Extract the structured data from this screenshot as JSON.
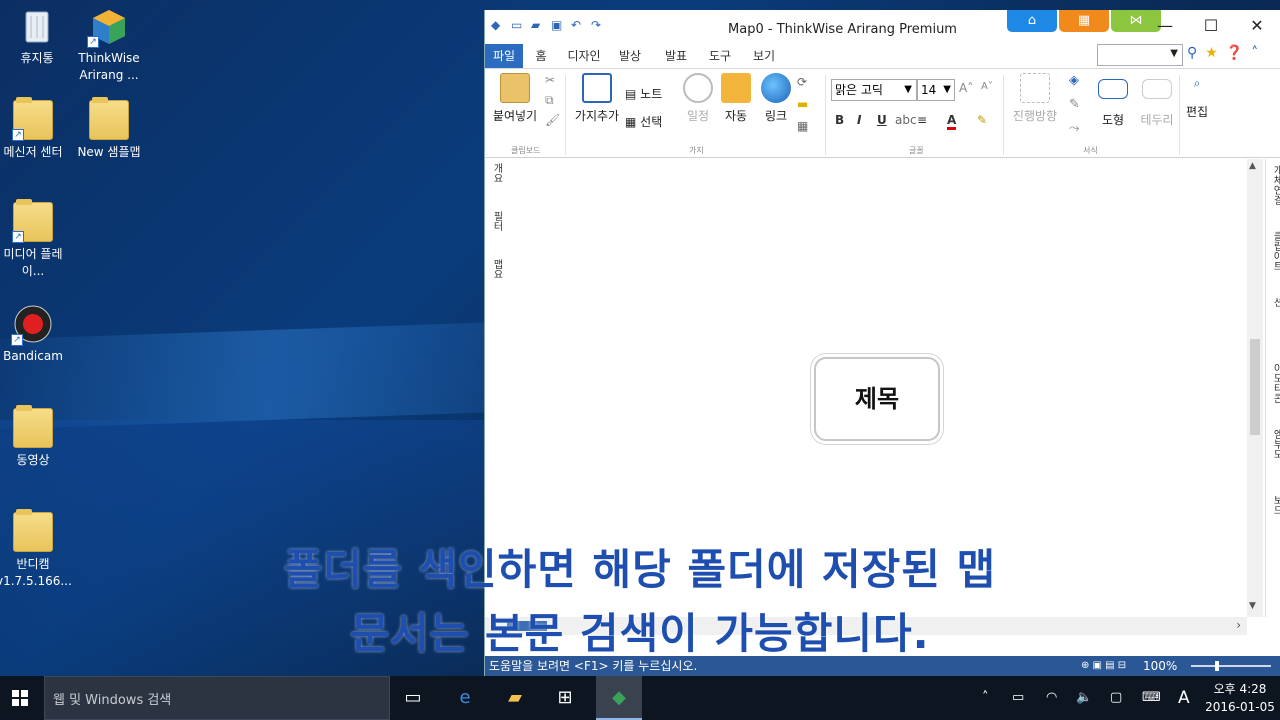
{
  "desktop": {
    "icons": [
      {
        "label": "휴지통"
      },
      {
        "label": "ThinkWise Arirang ..."
      },
      {
        "label": "메신저 센터"
      },
      {
        "label": "New 샘플맵"
      },
      {
        "label": "미디어 플레이..."
      },
      {
        "label": "Bandicam"
      },
      {
        "label": "동영상"
      },
      {
        "label": "반디캠 v1.7.5.166..."
      }
    ]
  },
  "app": {
    "title": "Map0 - ThinkWise Arirang Premium",
    "tabs": [
      "파일",
      "홈",
      "디자인",
      "발상",
      "발표",
      "도구",
      "보기"
    ],
    "ribbon": {
      "paste": "붙여넣기",
      "clipboard_group": "클립보드",
      "add_branch": "가지추가",
      "note": "노트",
      "select": "선택",
      "schedule": "일정",
      "auto": "자동",
      "link": "링크",
      "branch_group": "가지",
      "font_name": "맑은 고딕",
      "font_size": "14",
      "bold": "B",
      "italic": "I",
      "underline": "U",
      "font_group": "글꼴",
      "progress": "진행방향",
      "shape": "도형",
      "border": "테두리",
      "style_group": "서식",
      "edit": "편집"
    },
    "left_panel": [
      "개요",
      "필터",
      "맵요"
    ],
    "right_panel": [
      "개체연결",
      "클립아트",
      "프리젠테이션",
      "이모티콘",
      "엠부모",
      "보드"
    ],
    "topic": "제목",
    "status_message": "도움말을 보려면 <F1> 키를 누르십시오.",
    "zoom": "100%"
  },
  "subtitle": {
    "line1": "폴더를 색인하면 해당 폴더에 저장된 맵",
    "line2": "문서는 본문 검색이 가능합니다."
  },
  "taskbar": {
    "search_placeholder": "웹 및 Windows 검색",
    "ime": "A",
    "time": "오후 4:28",
    "date": "2016-01-05"
  }
}
